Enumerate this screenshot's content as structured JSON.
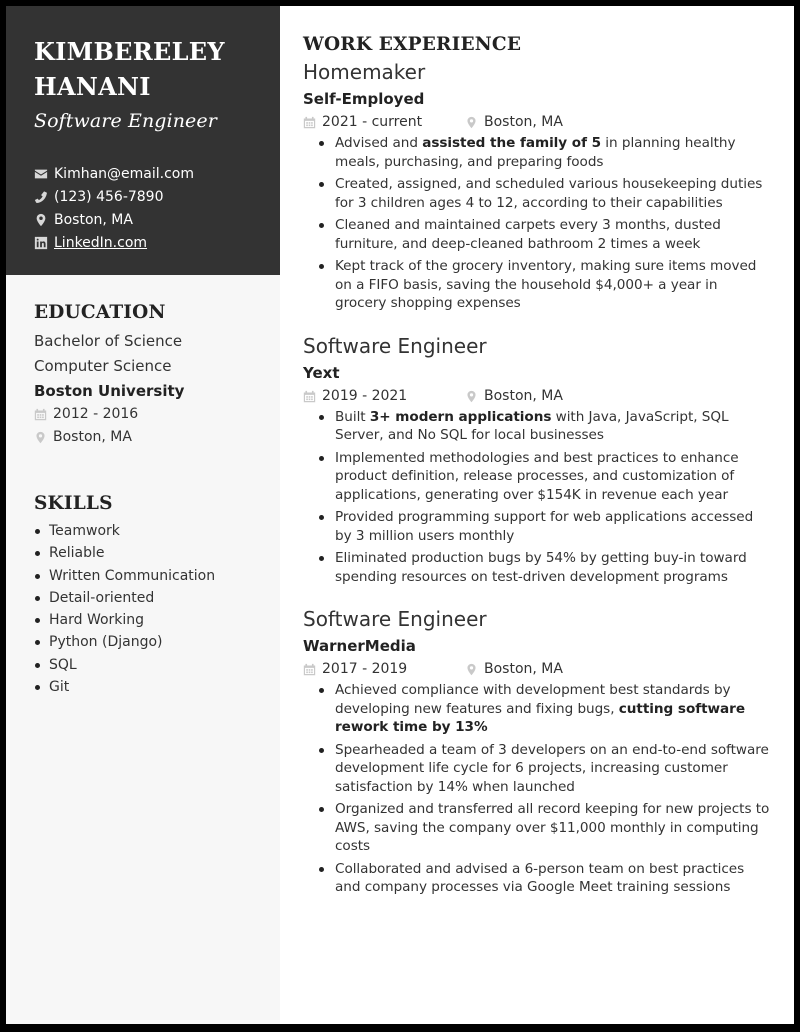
{
  "header": {
    "name_line1": "KIMBERELEY",
    "name_line2": "HANANI",
    "title": "Software Engineer",
    "contacts": {
      "email": {
        "icon": "envelope-icon",
        "value": "Kimhan@email.com"
      },
      "phone": {
        "icon": "phone-icon",
        "value": "(123) 456-7890"
      },
      "location": {
        "icon": "map-pin-icon",
        "value": "Boston, MA"
      },
      "linkedin": {
        "icon": "linkedin-icon",
        "value": "LinkedIn.com"
      }
    }
  },
  "education": {
    "heading": "EDUCATION",
    "degree": "Bachelor of Science",
    "field": "Computer Science",
    "school": "Boston University",
    "dates": "2012 - 2016",
    "location": "Boston, MA"
  },
  "skills": {
    "heading": "SKILLS",
    "items": [
      "Teamwork",
      "Reliable",
      "Written Communication",
      "Detail-oriented",
      "Hard Working",
      "Python (Django)",
      "SQL",
      "Git"
    ]
  },
  "work": {
    "heading": "WORK EXPERIENCE",
    "jobs": [
      {
        "title": "Homemaker",
        "company": "Self-Employed",
        "dates": "2021 - current",
        "location": "Boston, MA",
        "bullets": [
          {
            "pre": "Advised and ",
            "bold": "assisted the family of 5",
            "post": " in planning healthy meals, purchasing, and preparing foods"
          },
          {
            "pre": "Created, assigned, and scheduled various housekeeping duties for 3 children ages 4 to 12, according to their capabilities",
            "bold": "",
            "post": ""
          },
          {
            "pre": "Cleaned and maintained carpets every 3 months, dusted furniture, and deep-cleaned bathroom 2 times a week",
            "bold": "",
            "post": ""
          },
          {
            "pre": "Kept track of the grocery inventory, making sure items moved on a FIFO basis, saving the household $4,000+ a year in grocery shopping expenses",
            "bold": "",
            "post": ""
          }
        ]
      },
      {
        "title": "Software Engineer",
        "company": "Yext",
        "dates": "2019 - 2021",
        "location": "Boston, MA",
        "bullets": [
          {
            "pre": "Built ",
            "bold": "3+ modern applications",
            "post": " with Java, JavaScript, SQL Server, and No SQL for local businesses"
          },
          {
            "pre": "Implemented methodologies and best practices to enhance product definition, release processes, and customization of applications, generating over $154K in revenue each year",
            "bold": "",
            "post": ""
          },
          {
            "pre": "Provided programming support for web applications accessed by 3 million users monthly",
            "bold": "",
            "post": ""
          },
          {
            "pre": "Eliminated production bugs by 54% by getting buy-in toward spending resources on test-driven development programs",
            "bold": "",
            "post": ""
          }
        ]
      },
      {
        "title": "Software Engineer",
        "company": "WarnerMedia",
        "dates": "2017 - 2019",
        "location": "Boston, MA",
        "bullets": [
          {
            "pre": "Achieved compliance with development best standards by developing new features and fixing bugs, ",
            "bold": "cutting software rework time by 13%",
            "post": ""
          },
          {
            "pre": "Spearheaded a team of 3 developers on an end-to-end software development life cycle for 6 projects, increasing customer satisfaction by 14% when launched",
            "bold": "",
            "post": ""
          },
          {
            "pre": "Organized and transferred all record keeping for new projects to AWS, saving the company over $11,000 monthly in computing costs",
            "bold": "",
            "post": ""
          },
          {
            "pre": "Collaborated and advised a 6-person team on best practices and company processes via Google Meet training sessions",
            "bold": "",
            "post": ""
          }
        ]
      }
    ]
  },
  "colors": {
    "sidebar_header_bg": "#333333",
    "sidebar_bg": "#f7f7f7",
    "icon_gray": "#c9c9c9",
    "frame": "#000000"
  }
}
